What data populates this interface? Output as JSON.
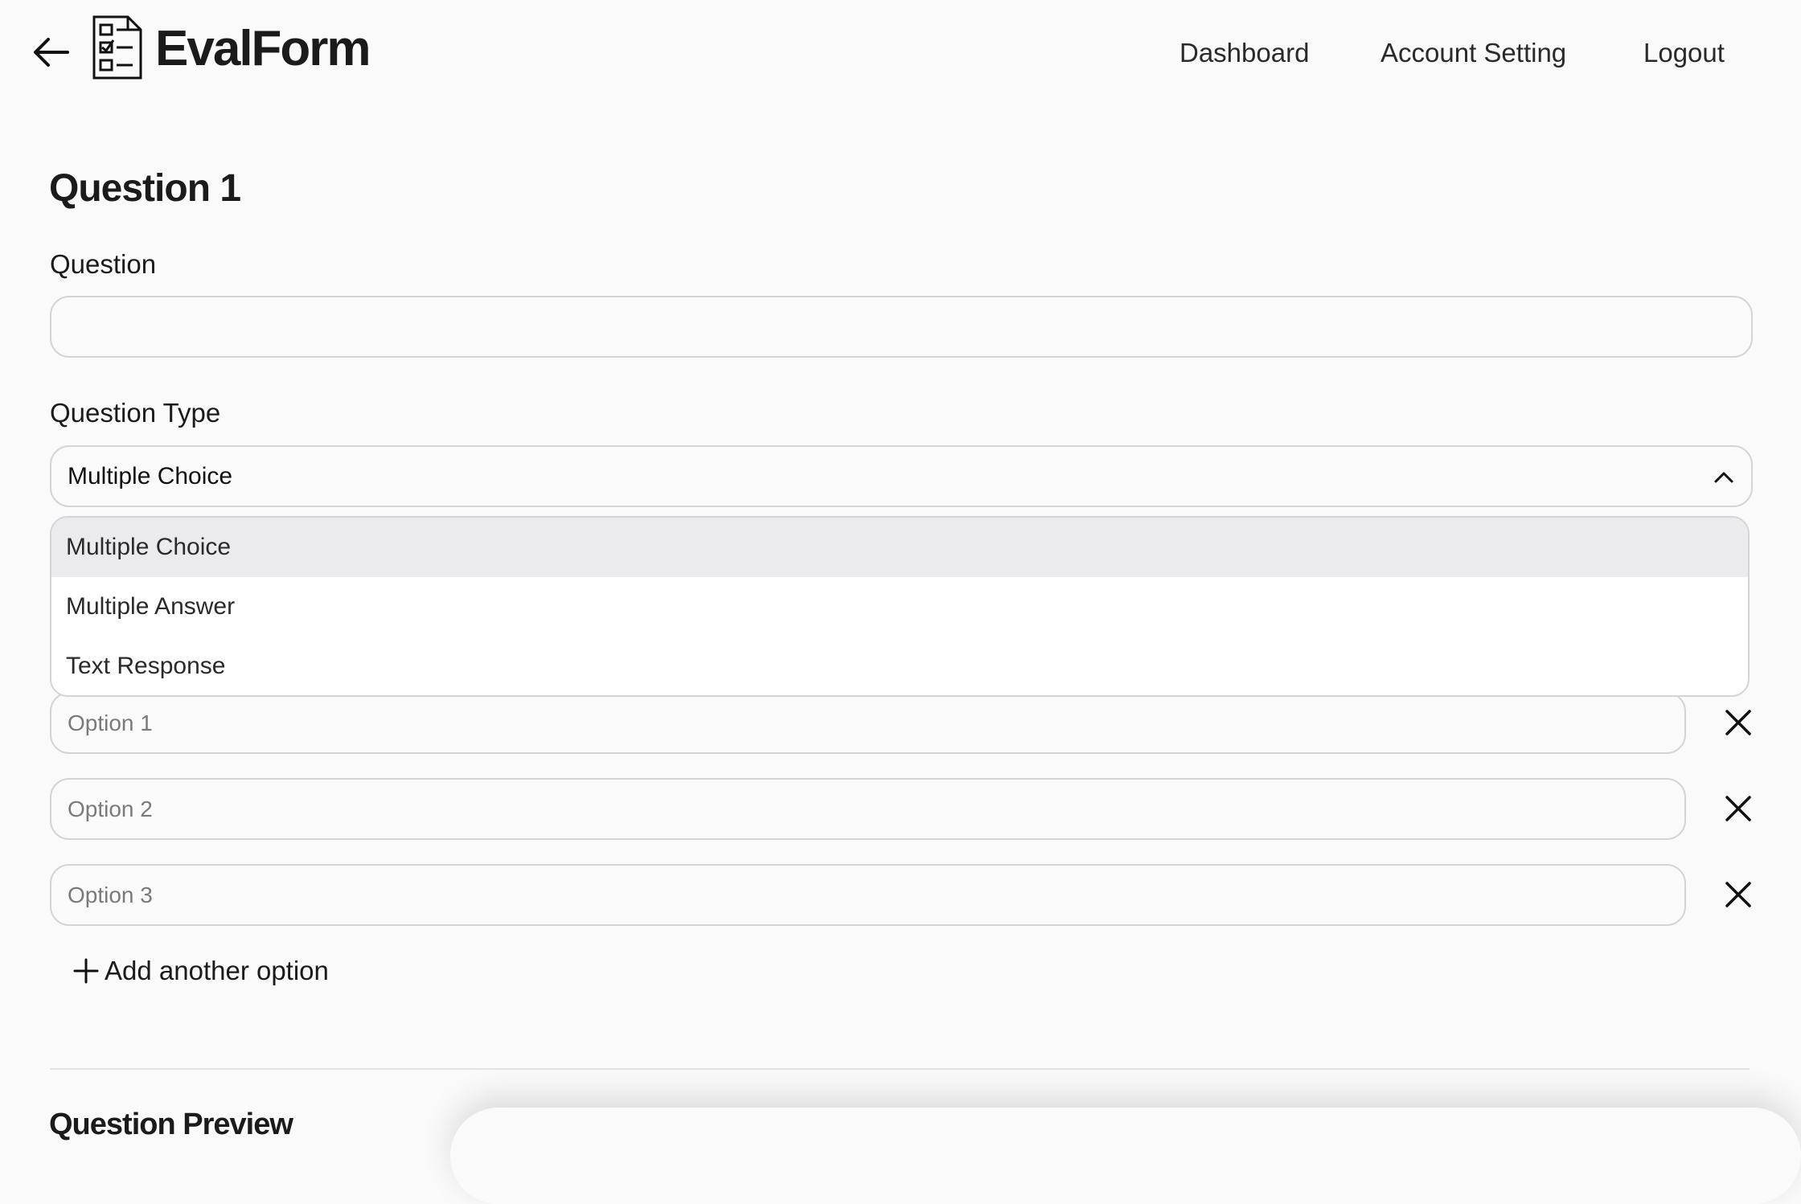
{
  "header": {
    "brand": "EvalForm",
    "nav": {
      "dashboard": "Dashboard",
      "account_setting": "Account Setting",
      "logout": "Logout"
    }
  },
  "main": {
    "title": "Question 1",
    "question": {
      "label": "Question",
      "value": ""
    },
    "question_type": {
      "label": "Question Type",
      "selected": "Multiple Choice",
      "options": [
        "Multiple Choice",
        "Multiple Answer",
        "Text Response"
      ],
      "dropdown_open": true
    },
    "answer_options": [
      {
        "placeholder": "Option 1",
        "value": ""
      },
      {
        "placeholder": "Option 2",
        "value": ""
      },
      {
        "placeholder": "Option 3",
        "value": ""
      }
    ],
    "add_option_label": "Add another option"
  },
  "preview": {
    "title": "Question Preview"
  },
  "icons": {
    "back": "arrow-left-icon",
    "logo": "checklist-document-icon",
    "dropdown": "chevron-up-icon",
    "remove": "close-icon",
    "add": "plus-icon"
  }
}
